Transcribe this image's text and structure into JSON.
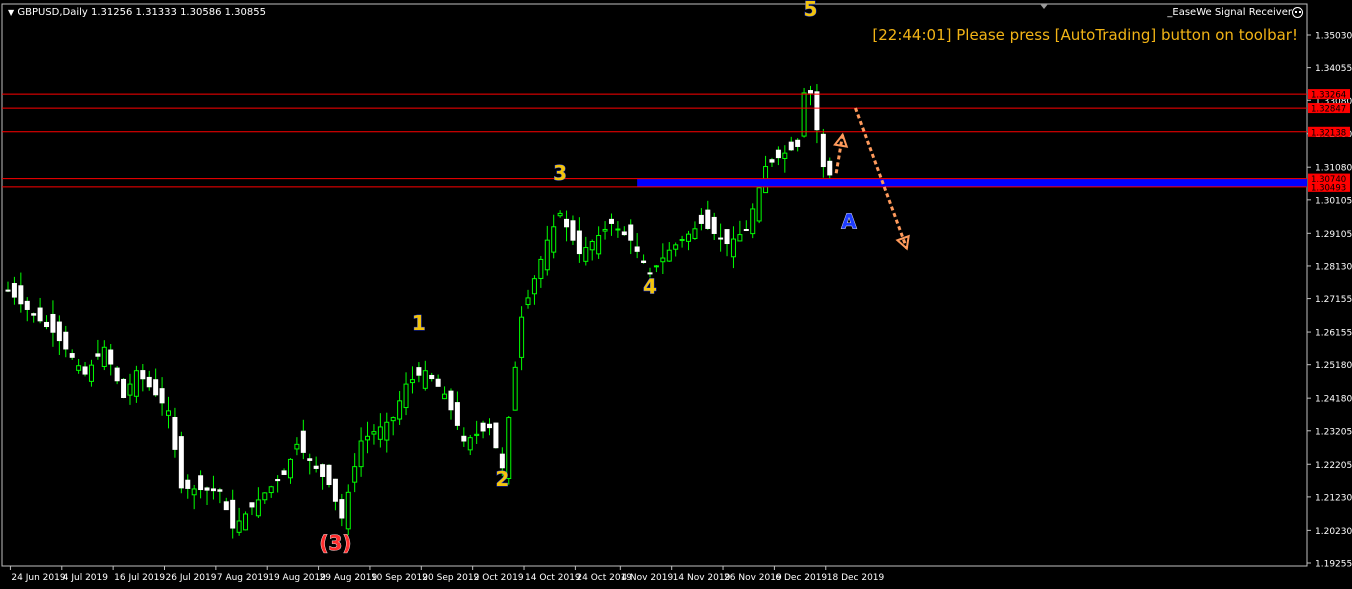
{
  "header": {
    "symbol_line": "GBPUSD,Daily  1.31256 1.31333 1.30586 1.30855",
    "ea_name": "_EaseWe Signal Receiver",
    "ea_icon": "smiley-face-icon",
    "alert": "[22:44:01] Please press [AutoTrading] button on toolbar!"
  },
  "colors": {
    "background": "#000000",
    "bull": "#00ff00",
    "bear_body": "#ffffff",
    "wick": "#00ff00",
    "level_line": "#ff0000",
    "zone": "#0000ff",
    "wave_label": "#f2c40c",
    "wave_outline": "#1e3cff",
    "red_label": "#ff2d2d",
    "arrow": "#ff9a5c",
    "axis_text": "#ffffff",
    "price_tag": "#ff0000"
  },
  "chart_data": {
    "type": "candlestick",
    "symbol": "GBPUSD",
    "timeframe": "Daily",
    "ylim": [
      1.1925,
      1.355
    ],
    "y_ticks": [
      "1.35030",
      "1.34055",
      "1.33080",
      "1.32080",
      "1.31080",
      "1.30105",
      "1.29105",
      "1.28130",
      "1.27155",
      "1.26155",
      "1.25180",
      "1.24180",
      "1.23205",
      "1.22205",
      "1.21230",
      "1.20230",
      "1.19255"
    ],
    "x_ticks": [
      "24 Jun 2019",
      "4 Jul 2019",
      "16 Jul 2019",
      "26 Jul 2019",
      "7 Aug 2019",
      "19 Aug 2019",
      "29 Aug 2019",
      "10 Sep 2019",
      "20 Sep 2019",
      "2 Oct 2019",
      "14 Oct 2019",
      "24 Oct 2019",
      "4 Nov 2019",
      "14 Nov 2019",
      "26 Nov 2019",
      "6 Dec 2019",
      "18 Dec 2019"
    ],
    "key_points": [
      {
        "date": "21 Jun 2019",
        "close": 1.274
      },
      {
        "date": "25 Jun 2019",
        "close": 1.27
      },
      {
        "date": "2 Jul 2019",
        "close": 1.2615
      },
      {
        "date": "9 Jul 2019",
        "close": 1.249
      },
      {
        "date": "12 Jul 2019",
        "close": 1.257
      },
      {
        "date": "17 Jul 2019",
        "close": 1.242
      },
      {
        "date": "19 Jul 2019",
        "close": 1.25
      },
      {
        "date": "26 Jul 2019",
        "close": 1.238
      },
      {
        "date": "30 Jul 2019",
        "close": 1.215
      },
      {
        "date": "7 Aug 2019",
        "close": 1.214
      },
      {
        "date": "9 Aug 2019",
        "close": 1.203
      },
      {
        "date": "16 Aug 2019",
        "close": 1.2135
      },
      {
        "date": "21 Aug 2019",
        "close": 1.219
      },
      {
        "date": "23 Aug 2019",
        "close": 1.228
      },
      {
        "date": "30 Aug 2019",
        "close": 1.216
      },
      {
        "date": "3 Sep 2019",
        "close": 1.206
      },
      {
        "date": "6 Sep 2019",
        "close": 1.229
      },
      {
        "date": "13 Sep 2019",
        "close": 1.236
      },
      {
        "date": "17 Sep 2019",
        "close": 1.246
      },
      {
        "date": "20 Sep 2019",
        "close": 1.25
      },
      {
        "date": "25 Sep 2019",
        "close": 1.243
      },
      {
        "date": "30 Sep 2019",
        "close": 1.229
      },
      {
        "date": "4 Oct 2019",
        "close": 1.233
      },
      {
        "date": "8 Oct 2019",
        "close": 1.221
      },
      {
        "date": "11 Oct 2019",
        "close": 1.266
      },
      {
        "date": "17 Oct 2019",
        "close": 1.289
      },
      {
        "date": "21 Oct 2019",
        "close": 1.297
      },
      {
        "date": "24 Oct 2019",
        "close": 1.285
      },
      {
        "date": "31 Oct 2019",
        "close": 1.294
      },
      {
        "date": "5 Nov 2019",
        "close": 1.289
      },
      {
        "date": "8 Nov 2019",
        "close": 1.279
      },
      {
        "date": "13 Nov 2019",
        "close": 1.286
      },
      {
        "date": "20 Nov 2019",
        "close": 1.294
      },
      {
        "date": "26 Nov 2019",
        "close": 1.288
      },
      {
        "date": "29 Nov 2019",
        "close": 1.292
      },
      {
        "date": "4 Dec 2019",
        "close": 1.311
      },
      {
        "date": "9 Dec 2019",
        "close": 1.315
      },
      {
        "date": "11 Dec 2019",
        "close": 1.317
      },
      {
        "date": "12 Dec 2019",
        "close": 1.333
      },
      {
        "date": "13 Dec 2019",
        "close": 1.333
      },
      {
        "date": "17 Dec 2019",
        "close": 1.311
      },
      {
        "date": "18 Dec 2019",
        "close": 1.3085
      }
    ],
    "horizontal_levels": [
      {
        "label": "1.33264",
        "price": 1.33264
      },
      {
        "label": "1.32847",
        "price": 1.32847
      },
      {
        "label": "1.32138",
        "price": 1.32138
      },
      {
        "label": "1.30740",
        "price": 1.3074
      },
      {
        "label": "1.30493",
        "price": 1.30493
      }
    ],
    "zone": {
      "date_start": "6 Nov 2019",
      "price": 1.3062
    },
    "wave_labels": [
      {
        "text": "(3)",
        "date": "2 Sep 2019",
        "price": 1.1965,
        "style": "red"
      },
      {
        "text": "1",
        "date": "19 Sep 2019",
        "price": 1.2622,
        "style": "yellow"
      },
      {
        "text": "2",
        "date": "8 Oct 2019",
        "price": 1.2155,
        "style": "yellow"
      },
      {
        "text": "3",
        "date": "21 Oct 2019",
        "price": 1.307,
        "style": "yellow"
      },
      {
        "text": "4",
        "date": "8 Nov 2019",
        "price": 1.273,
        "style": "yellow"
      },
      {
        "text": "5",
        "date": "13 Dec 2019",
        "price": 1.356,
        "style": "yellow"
      },
      {
        "text": "A",
        "date": "23 Dec 2019",
        "price": 1.2925,
        "style": "blue"
      }
    ],
    "arrows": [
      {
        "from_date": "19 Dec 2019",
        "from_price": 1.309,
        "to_date": "22 Dec 2019",
        "to_price": 1.3205
      },
      {
        "from_date": "24 Dec 2019",
        "from_price": 1.3285,
        "to_date": "3 Jan 2020",
        "to_price": 1.2865
      }
    ]
  }
}
